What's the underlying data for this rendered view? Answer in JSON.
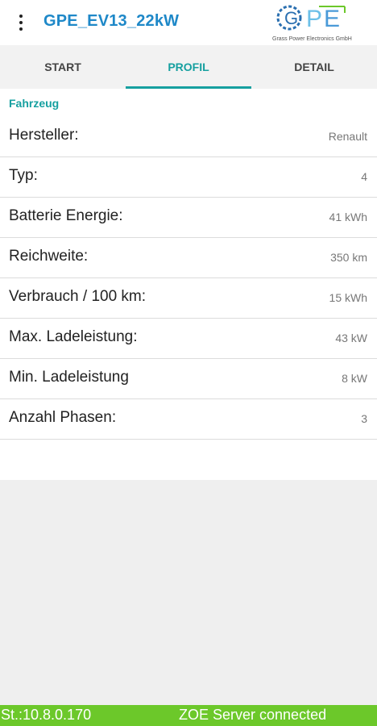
{
  "colors": {
    "accent": "#16a0a0",
    "title": "#1e88c8",
    "status_bar": "#6cc82a"
  },
  "appbar": {
    "menu_icon": "overflow-menu-icon",
    "title": "GPE_EV13_22kW",
    "logo": {
      "letters": "GPE",
      "subtitle": "Grass Power Electronics GmbH"
    }
  },
  "tabs": [
    {
      "label": "START",
      "active": false
    },
    {
      "label": "PROFIL",
      "active": true
    },
    {
      "label": "DETAIL",
      "active": false
    }
  ],
  "profile": {
    "section_title": "Fahrzeug",
    "rows": [
      {
        "label": "Hersteller:",
        "value": "Renault"
      },
      {
        "label": "Typ:",
        "value": "4"
      },
      {
        "label": "Batterie Energie:",
        "value": "41 kWh"
      },
      {
        "label": "Reichweite:",
        "value": "350 km"
      },
      {
        "label": "Verbrauch / 100 km:",
        "value": "15 kWh"
      },
      {
        "label": "Max. Ladeleistung:",
        "value": "43 kW"
      },
      {
        "label": "Min. Ladeleistung",
        "value": "8 kW"
      },
      {
        "label": "Anzahl Phasen:",
        "value": "3"
      }
    ]
  },
  "status": {
    "left": "St.:10.8.0.170",
    "right": "ZOE Server connected"
  }
}
